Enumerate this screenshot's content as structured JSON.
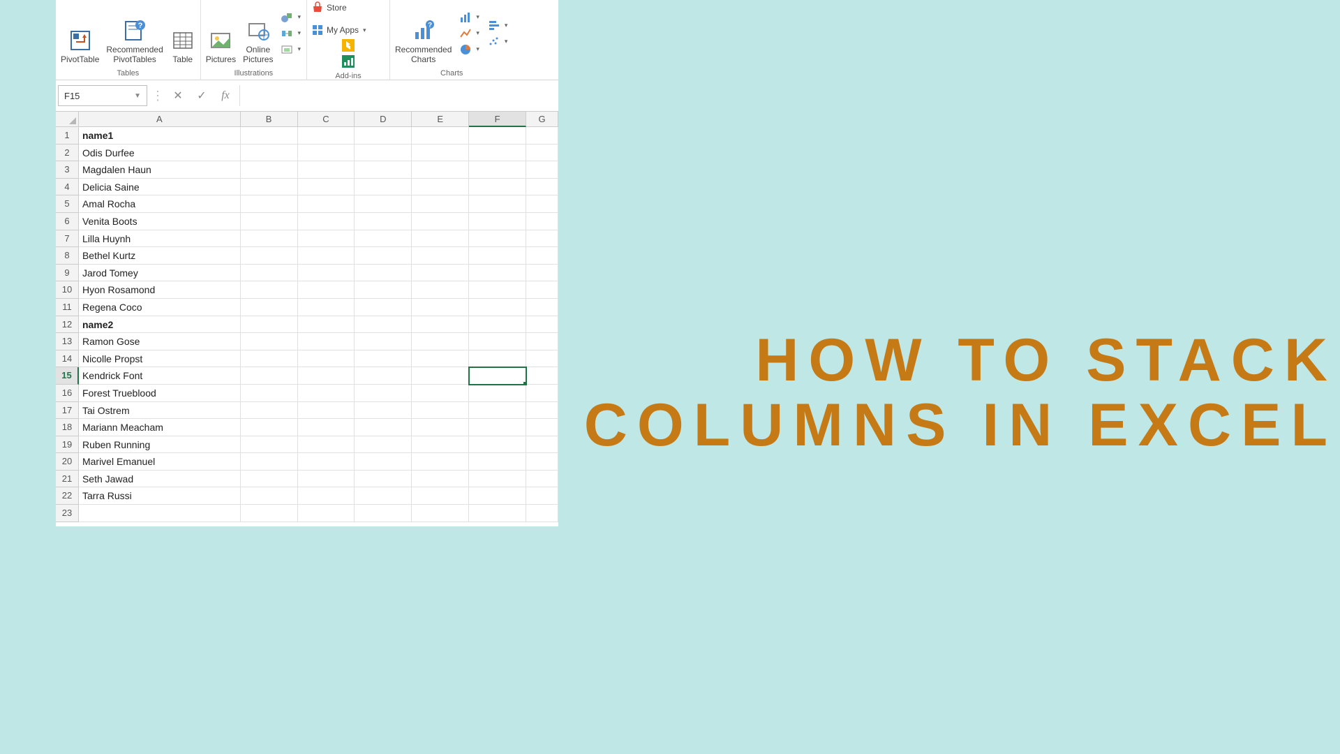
{
  "overlay": {
    "line1": "HOW TO STACK",
    "line2": "COLUMNS IN EXCEL"
  },
  "ribbon": {
    "groups": {
      "tables": {
        "label": "Tables",
        "pivot": "PivotTable",
        "recpivot1": "Recommended",
        "recpivot2": "PivotTables",
        "table": "Table"
      },
      "illustrations": {
        "label": "Illustrations",
        "pictures": "Pictures",
        "online1": "Online",
        "online2": "Pictures"
      },
      "addins": {
        "label": "Add-ins",
        "store": "Store",
        "myapps": "My Apps"
      },
      "charts": {
        "label": "Charts",
        "rec1": "Recommended",
        "rec2": "Charts"
      }
    }
  },
  "formula_bar": {
    "cell_ref": "F15",
    "fx": "fx",
    "value": ""
  },
  "columns": [
    "A",
    "B",
    "C",
    "D",
    "E",
    "F",
    "G"
  ],
  "active_col_index": 5,
  "active_row": 15,
  "rows": [
    {
      "n": 1,
      "a": "name1",
      "bold": true
    },
    {
      "n": 2,
      "a": "Odis Durfee"
    },
    {
      "n": 3,
      "a": "Magdalen Haun"
    },
    {
      "n": 4,
      "a": "Delicia Saine"
    },
    {
      "n": 5,
      "a": "Amal Rocha"
    },
    {
      "n": 6,
      "a": "Venita Boots"
    },
    {
      "n": 7,
      "a": "Lilla Huynh"
    },
    {
      "n": 8,
      "a": "Bethel Kurtz"
    },
    {
      "n": 9,
      "a": "Jarod Tomey"
    },
    {
      "n": 10,
      "a": "Hyon Rosamond"
    },
    {
      "n": 11,
      "a": "Regena Coco"
    },
    {
      "n": 12,
      "a": "name2",
      "bold": true
    },
    {
      "n": 13,
      "a": "Ramon Gose"
    },
    {
      "n": 14,
      "a": "Nicolle Propst"
    },
    {
      "n": 15,
      "a": "Kendrick Font"
    },
    {
      "n": 16,
      "a": "Forest Trueblood"
    },
    {
      "n": 17,
      "a": "Tai Ostrem"
    },
    {
      "n": 18,
      "a": "Mariann Meacham"
    },
    {
      "n": 19,
      "a": "Ruben Running"
    },
    {
      "n": 20,
      "a": "Marivel Emanuel"
    },
    {
      "n": 21,
      "a": "Seth Jawad"
    },
    {
      "n": 22,
      "a": "Tarra Russi"
    },
    {
      "n": 23,
      "a": ""
    }
  ]
}
